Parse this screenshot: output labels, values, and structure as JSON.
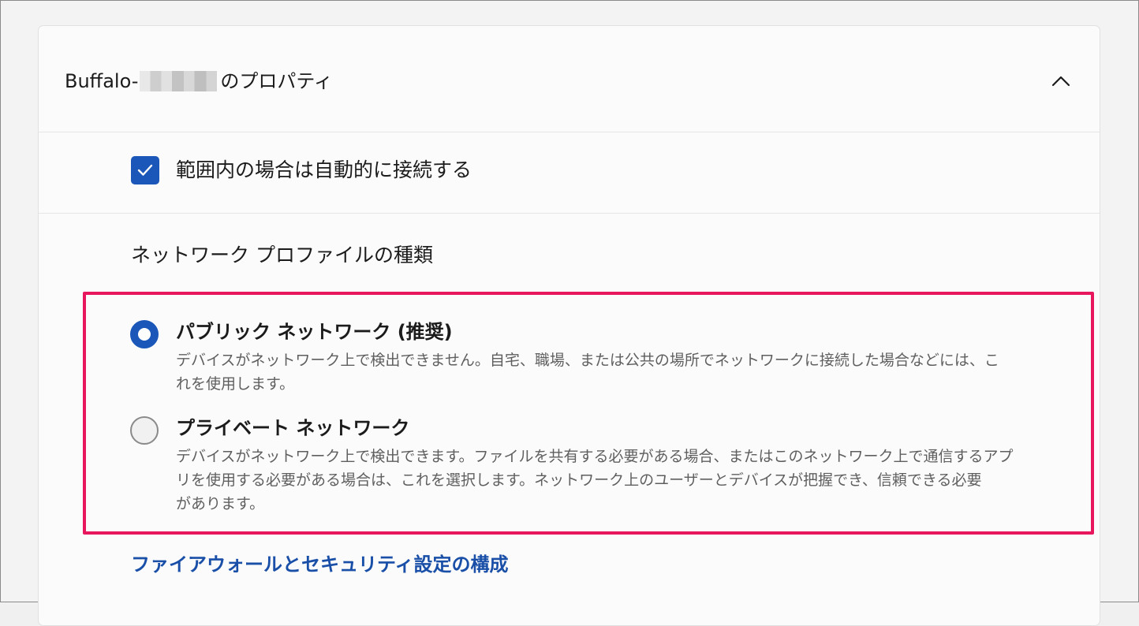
{
  "header": {
    "title_prefix": "Buffalo-",
    "title_suffix": "のプロパティ",
    "collapse_icon": "chevron-up-icon"
  },
  "auto_connect": {
    "checked": true,
    "label": "範囲内の場合は自動的に接続する"
  },
  "profile": {
    "section_title": "ネットワーク プロファイルの種類",
    "options": [
      {
        "title": "パブリック ネットワーク (推奨)",
        "selected": true,
        "description_lines": [
          "デバイスがネットワーク上で検出できません。自宅、職場、または公共の場所でネットワークに接続した場合などには、こ",
          "れを使用します。"
        ]
      },
      {
        "title": "プライベート ネットワーク",
        "selected": false,
        "description_lines": [
          "デバイスがネットワーク上で検出できます。ファイルを共有する必要がある場合、またはこのネットワーク上で通信するアプ",
          "リを使用する必要がある場合は、これを選択します。ネットワーク上のユーザーとデバイスが把握でき、信頼できる必要",
          "があります。"
        ]
      }
    ]
  },
  "firewall_link": "ファイアウォールとセキュリティ設定の構成",
  "colors": {
    "accent": "#1a57b8",
    "highlight": "#e8175d",
    "link": "#1a4fa8"
  }
}
